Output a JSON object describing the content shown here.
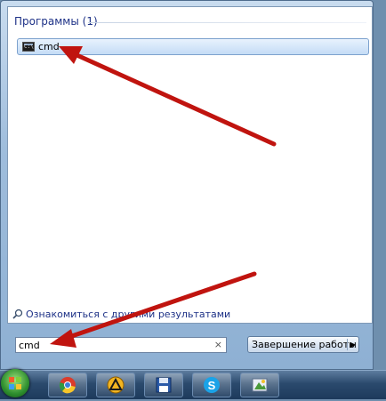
{
  "start_menu": {
    "group_header": "Программы (1)",
    "results": [
      {
        "label": "cmd",
        "icon": "cmd-console-icon"
      }
    ],
    "see_more_label": "Ознакомиться с другими результатами",
    "search": {
      "value": "cmd",
      "clear_glyph": "×"
    },
    "shutdown": {
      "label": "Завершение работы",
      "arrow_glyph": "▶"
    }
  },
  "taskbar": {
    "items": [
      {
        "name": "start-orb"
      },
      {
        "name": "chrome-icon"
      },
      {
        "name": "daemon-tools-icon"
      },
      {
        "name": "floppy-save-icon"
      },
      {
        "name": "skype-icon"
      },
      {
        "name": "paint-icon"
      }
    ]
  },
  "annotations": {
    "arrow_color": "#c0140f"
  }
}
